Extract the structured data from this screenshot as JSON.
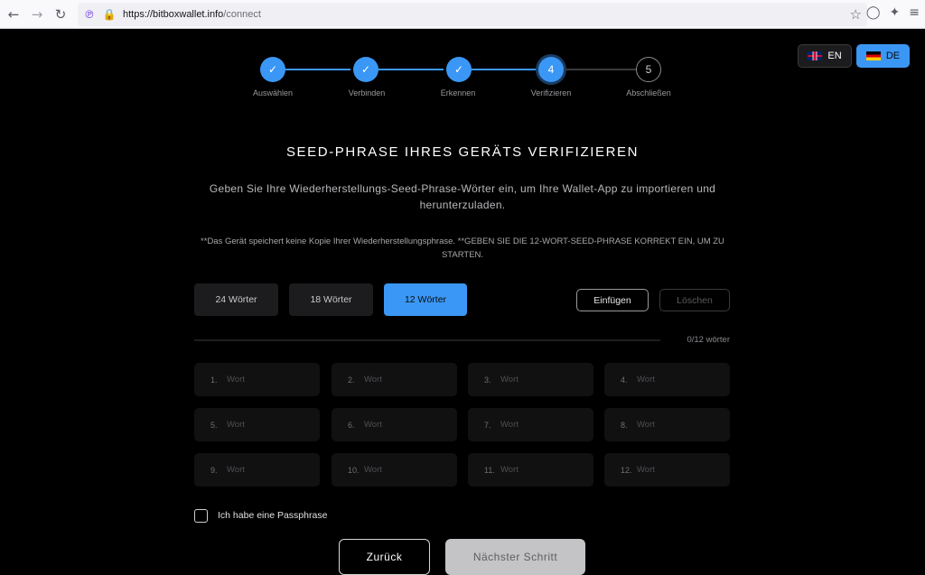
{
  "browser": {
    "url_host": "https://bitboxwallet.info",
    "url_path": "/connect"
  },
  "lang": {
    "en": "EN",
    "de": "DE"
  },
  "steps": [
    {
      "label": "Auswählen",
      "state": "done",
      "mark": "✓"
    },
    {
      "label": "Verbinden",
      "state": "done",
      "mark": "✓"
    },
    {
      "label": "Erkennen",
      "state": "done",
      "mark": "✓"
    },
    {
      "label": "Verifizieren",
      "state": "active",
      "mark": "4"
    },
    {
      "label": "Abschließen",
      "state": "todo",
      "mark": "5"
    }
  ],
  "title": "SEED-PHRASE IHRES GERÄTS VERIFIZIEREN",
  "subtitle": "Geben Sie Ihre Wiederherstellungs-Seed-Phrase-Wörter ein, um Ihre Wallet-App zu importieren und herunterzuladen.",
  "notice": "**Das Gerät speichert keine Kopie Ihrer Wiederherstellungsphrase. **GEBEN SIE DIE 12-WORT-SEED-PHRASE KORREKT EIN, UM ZU STARTEN.",
  "word_count_options": [
    "24 Wörter",
    "18 Wörter",
    "12 Wörter"
  ],
  "selected_word_count": "12 Wörter",
  "actions": {
    "paste": "Einfügen",
    "clear": "Löschen"
  },
  "progress": {
    "text": "0/12 wörter",
    "filled": 0,
    "total": 12
  },
  "words": [
    {
      "num": "1.",
      "placeholder": "Wort"
    },
    {
      "num": "2.",
      "placeholder": "Wort"
    },
    {
      "num": "3.",
      "placeholder": "Wort"
    },
    {
      "num": "4.",
      "placeholder": "Wort"
    },
    {
      "num": "5.",
      "placeholder": "Wort"
    },
    {
      "num": "6.",
      "placeholder": "Wort"
    },
    {
      "num": "7.",
      "placeholder": "Wort"
    },
    {
      "num": "8.",
      "placeholder": "Wort"
    },
    {
      "num": "9.",
      "placeholder": "Wort"
    },
    {
      "num": "10.",
      "placeholder": "Wort"
    },
    {
      "num": "11.",
      "placeholder": "Wort"
    },
    {
      "num": "12.",
      "placeholder": "Wort"
    }
  ],
  "passphrase_label": "Ich habe eine Passphrase",
  "passphrase_checked": false,
  "buttons": {
    "back": "Zurück",
    "next": "Nächster Schritt"
  },
  "colors": {
    "accent": "#3b97f5",
    "background": "#000000"
  }
}
